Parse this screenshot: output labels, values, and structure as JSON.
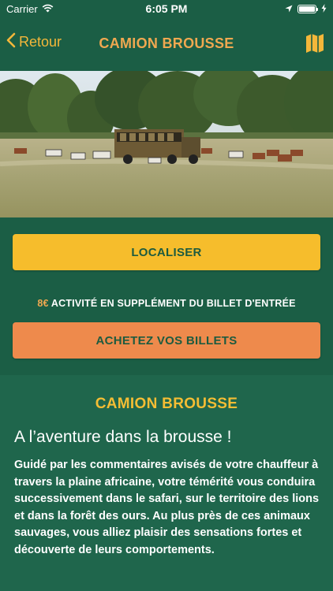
{
  "status_bar": {
    "carrier": "Carrier",
    "time": "6:05 PM",
    "battery_level": 1.0
  },
  "nav": {
    "back_label": "Retour",
    "title": "CAMION BROUSSE",
    "back_icon": "chevron-left-icon",
    "map_icon": "map-icon"
  },
  "actions": {
    "localiser_label": "LOCALISER",
    "price_amount": "8€",
    "price_text": "ACTIVITÉ EN SUPPLÉMENT DU BILLET D'ENTRÉE",
    "tickets_label": "ACHETEZ VOS BILLETS"
  },
  "content": {
    "section_title": "CAMION BROUSSE",
    "headline": "A l’aventure dans la brousse !",
    "description": "Guidé par les commentaires avisés de votre chauffeur à travers la plaine africaine, votre témérité vous conduira successivement dans le safari, sur le territoire des lions et dans la forêt des ours. Au plus près de ces animaux sauvages, vous alliez plaisir des sensations fortes et découverte de leurs comportements."
  },
  "colors": {
    "background": "#1b5e45",
    "panel": "#1f664c",
    "accent_yellow": "#f6bd2c",
    "accent_orange": "#ee8a4c",
    "title_orange": "#f0a850"
  }
}
